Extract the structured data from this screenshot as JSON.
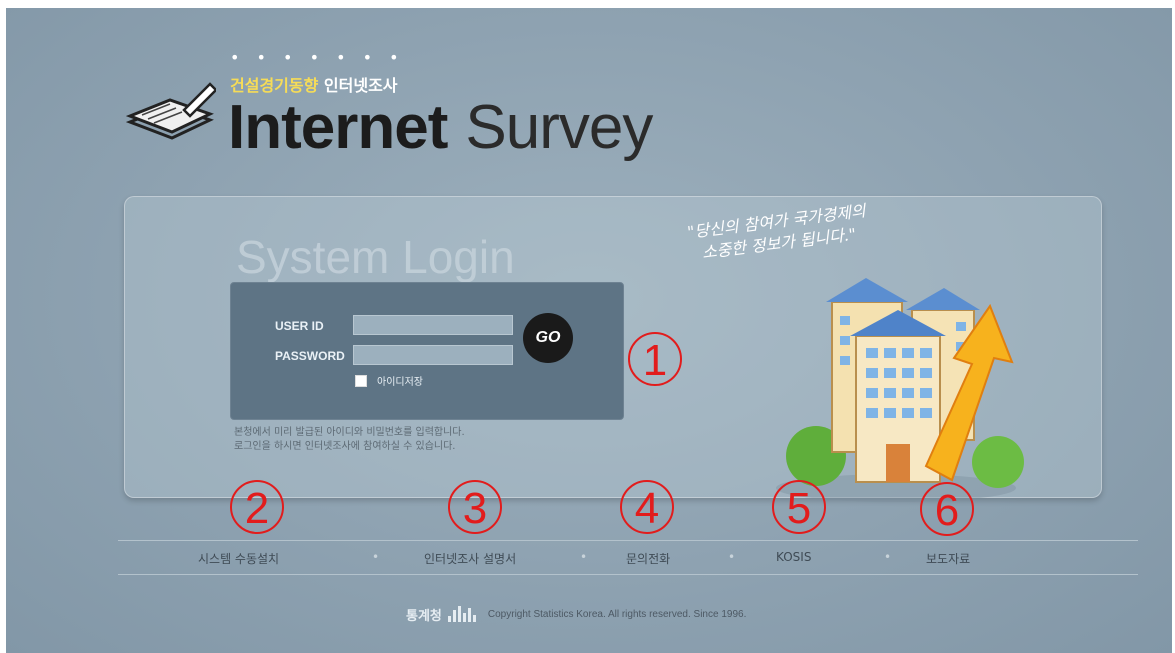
{
  "header": {
    "dots": "• • • • • • •",
    "subtitle_highlight": "건설경기동향",
    "subtitle_rest": "인터넷조사",
    "brand_bold": "Internet",
    "brand_light": "Survey"
  },
  "login": {
    "heading": "System Login",
    "user_id_label": "USER ID",
    "password_label": "PASSWORD",
    "user_id_value": "",
    "password_value": "",
    "go_label": "GO",
    "save_id_label": "아이디저장",
    "help_line1": "본청에서 미리 발급된 아이디와 비밀번호를 입력합니다.",
    "help_line2": "로그인을 하시면 인터넷조사에 참여하실 수 있습니다."
  },
  "slogan": {
    "line1": "\"당신의 참여가 국가경제의",
    "line2": "소중한 정보가 됩니다.\""
  },
  "annotations": {
    "n1": "1",
    "n2": "2",
    "n3": "3",
    "n4": "4",
    "n5": "5",
    "n6": "6"
  },
  "nav": {
    "items": [
      {
        "label": "시스템 수동설치"
      },
      {
        "label": "인터넷조사 설명서"
      },
      {
        "label": "문의전화"
      },
      {
        "label": "KOSIS"
      },
      {
        "label": "보도자료"
      }
    ],
    "separator": "•"
  },
  "footer": {
    "org": "통계청",
    "copyright": "Copyright  Statistics Korea. All rights reserved. Since 1996."
  },
  "colors": {
    "background": "#8fa3b2",
    "login_box": "#5e7485",
    "annotation_red": "#e21c1c",
    "highlight_yellow": "#f6dc57"
  }
}
